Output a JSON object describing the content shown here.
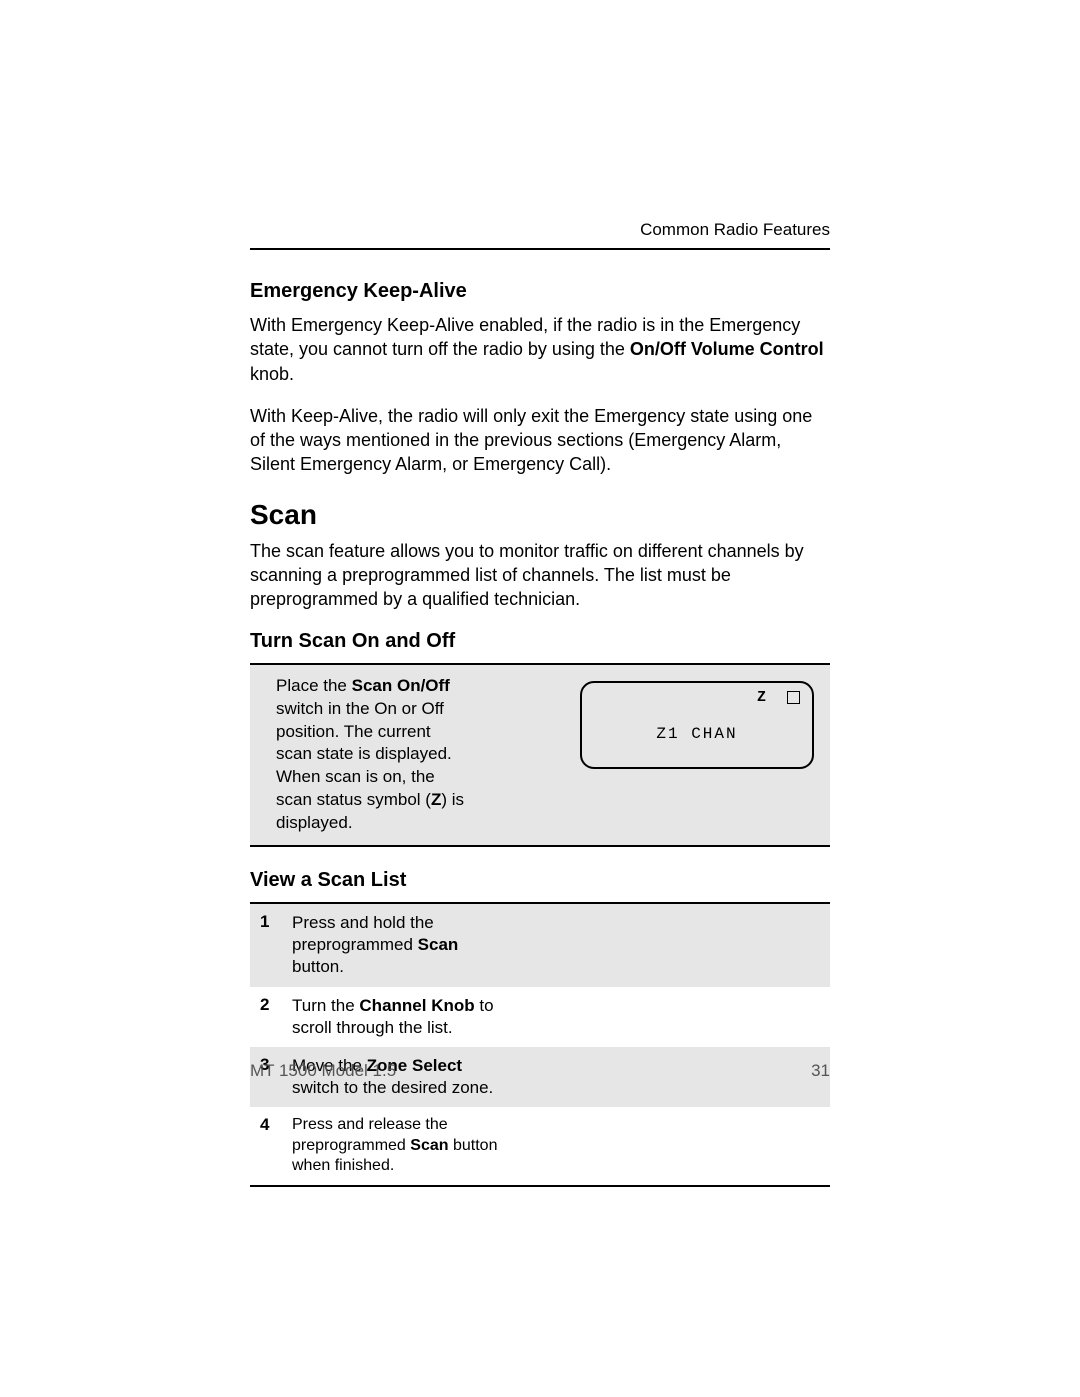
{
  "running_head": "Common Radio Features",
  "sections": {
    "eka": {
      "title": "Emergency Keep-Alive",
      "para1_pre": "With Emergency Keep-Alive enabled, if the radio is in the Emergency state, you cannot turn off the radio by using the ",
      "para1_bold": "On/Off Volume Control",
      "para1_post": " knob.",
      "para2": "With Keep-Alive, the radio will only exit the Emergency state using one of the ways mentioned in the previous sections (Emergency Alarm, Silent Emergency Alarm, or Emergency Call)."
    },
    "scan": {
      "title": "Scan",
      "intro": "The scan feature allows you to monitor traffic on different channels by scanning a preprogrammed list of channels. The list must be preprogrammed by a qualified technician."
    },
    "turn": {
      "title": "Turn Scan On and Off",
      "text_pre": "Place the ",
      "text_bold": "Scan On/Off",
      "text_post1": " switch in the On or Off position. The current scan state is displayed. When scan is on, the scan status symbol (",
      "icon": "Z",
      "text_post2": ") is displayed."
    },
    "lcd": {
      "scan_icon": "Z",
      "display_text": "Z1 CHAN"
    },
    "view": {
      "title": "View a Scan List",
      "steps": [
        {
          "num": "1",
          "pre": "Press and hold the preprogrammed ",
          "bold": "Scan",
          "post": " button."
        },
        {
          "num": "2",
          "pre": "Turn the ",
          "bold": "Channel Knob",
          "post": " to scroll through the list."
        },
        {
          "num": "3",
          "pre": "Move the ",
          "bold": "Zone Select",
          "post": " switch to the desired zone."
        },
        {
          "num": "4",
          "pre": "Press ",
          "mid": "and release the preprogrammed ",
          "bold": "Scan",
          "post": " button when finished.",
          "small": true
        }
      ]
    }
  },
  "footer": {
    "left": "MT 1500 Model 1.5",
    "right": "31"
  }
}
